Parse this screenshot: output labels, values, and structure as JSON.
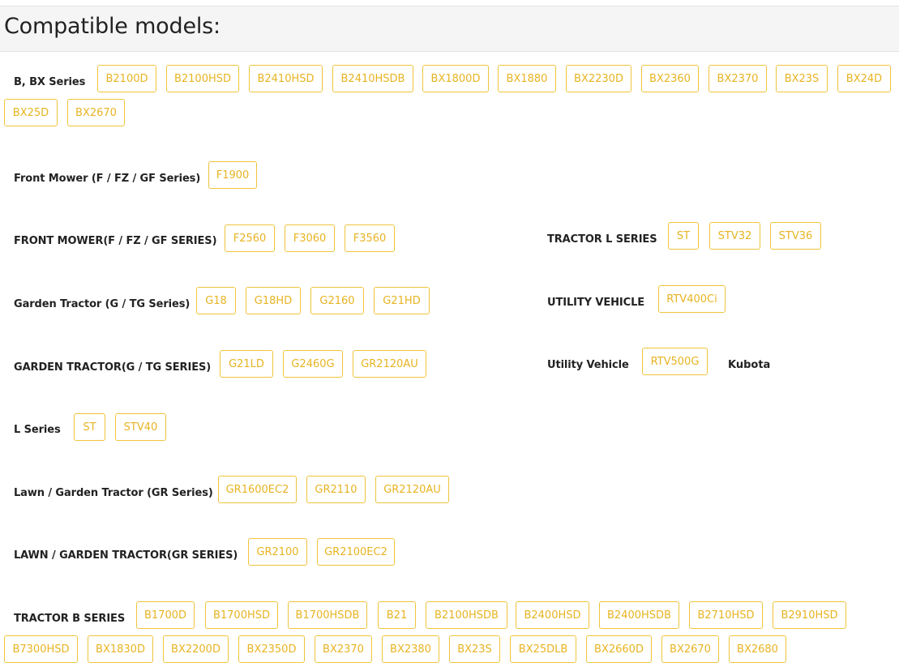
{
  "header": {
    "title": "Compatible models:"
  },
  "groups": [
    {
      "label": "B, BX Series",
      "models": [
        "B2100D",
        "B2100HSD",
        "B2410HSD",
        "B2410HSDB",
        "BX1800D",
        "BX1880",
        "BX2230D",
        "BX2360",
        "BX2370",
        "BX23S",
        "BX24D",
        "BX25D",
        "BX2670"
      ]
    },
    {
      "label": "Front Mower (F / FZ / GF Series)",
      "models": [
        "F1900"
      ]
    },
    {
      "label": "FRONT MOWER(F / FZ / GF SERIES)",
      "models": [
        "F2560",
        "F3060",
        "F3560"
      ]
    },
    {
      "label": "TRACTOR L SERIES",
      "models": [
        "ST",
        "STV32",
        "STV36"
      ]
    },
    {
      "label": "Garden Tractor (G / TG Series)",
      "models": [
        "G18",
        "G18HD",
        "G2160",
        "G21HD"
      ]
    },
    {
      "label": "UTILITY VEHICLE",
      "models": [
        "RTV400Ci"
      ]
    },
    {
      "label": "GARDEN TRACTOR(G / TG SERIES)",
      "models": [
        "G21LD",
        "G2460G",
        "GR2120AU"
      ]
    },
    {
      "label": "Utility Vehicle",
      "models": [
        "RTV500G"
      ],
      "brand": "Kubota"
    },
    {
      "label": "L Series",
      "models": [
        "ST",
        "STV40"
      ]
    },
    {
      "label": "Lawn / Garden Tractor (GR Series)",
      "models": [
        "GR1600EC2",
        "GR2110",
        "GR2120AU"
      ]
    },
    {
      "label": "LAWN / GARDEN TRACTOR(GR SERIES)",
      "models": [
        "GR2100",
        "GR2100EC2"
      ]
    },
    {
      "label": "TRACTOR B SERIES",
      "models": [
        "B1700D",
        "B1700HSD",
        "B1700HSDB",
        "B21",
        "B2100HSDB",
        "B2400HSD",
        "B2400HSDB",
        "B2710HSD",
        "B2910HSD",
        "B7300HSD",
        "BX1830D",
        "BX2200D",
        "BX2350D",
        "BX2370",
        "BX2380",
        "BX23S",
        "BX25DLB",
        "BX2660D",
        "BX2670",
        "BX2680"
      ]
    }
  ],
  "colors": {
    "chip_border": "#f0c43c",
    "chip_text": "#e7b422",
    "header_bg": "#f5f5f5"
  }
}
